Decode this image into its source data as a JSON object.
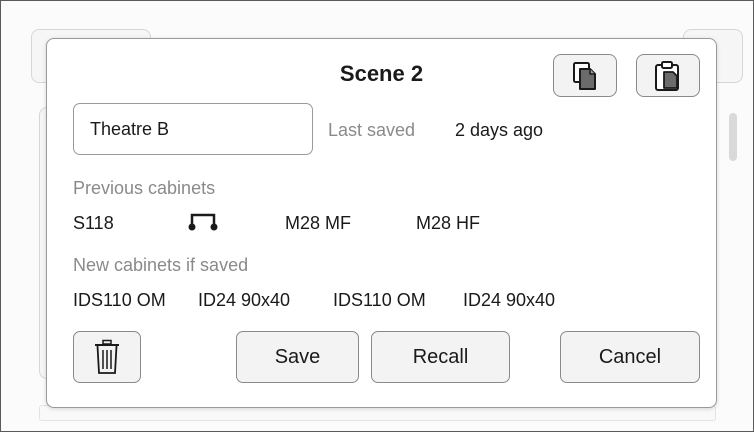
{
  "dialog": {
    "title": "Scene 2",
    "name_value": "Theatre B",
    "last_saved_label": "Last saved",
    "last_saved_value": "2 days ago",
    "previous_label": "Previous cabinets",
    "previous_cabinets": [
      "S118",
      "M28 MF",
      "M28 HF"
    ],
    "previous_cabinet_icon": "cable-connector-icon",
    "new_label": "New cabinets if saved",
    "new_cabinets": [
      "IDS110 OM",
      "ID24 90x40",
      "IDS110 OM",
      "ID24 90x40"
    ],
    "copy_icon": "copy-icon",
    "paste_icon": "paste-icon",
    "delete_icon": "trash-icon",
    "save_label": "Save",
    "recall_label": "Recall",
    "cancel_label": "Cancel"
  }
}
